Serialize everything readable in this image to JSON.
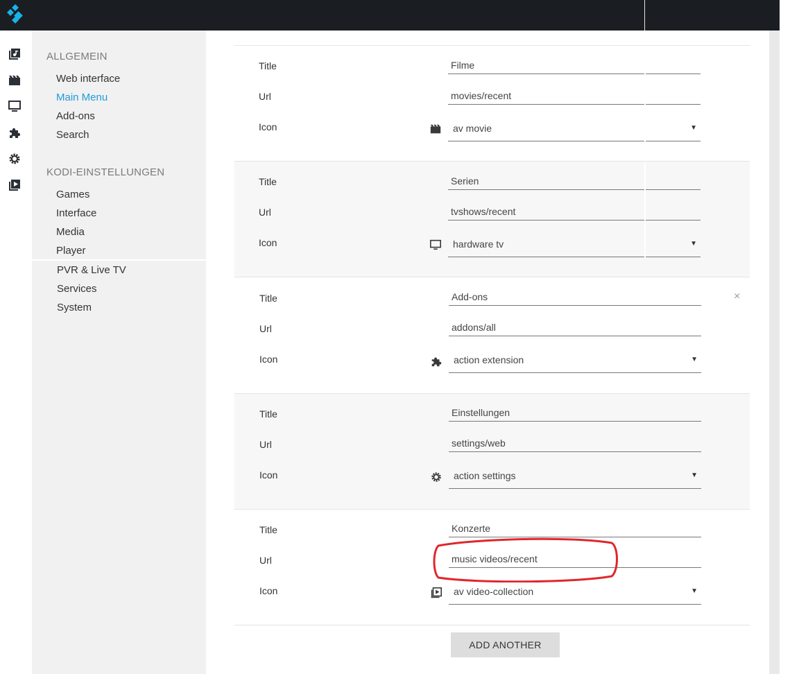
{
  "sidebar": {
    "sections": [
      {
        "heading": "ALLGEMEIN",
        "items": [
          {
            "label": "Web interface"
          },
          {
            "label": "Main Menu"
          },
          {
            "label": "Add-ons"
          },
          {
            "label": "Search"
          }
        ]
      },
      {
        "heading": "KODI-EINSTELLUNGEN",
        "items": [
          {
            "label": "Games"
          },
          {
            "label": "Interface"
          },
          {
            "label": "Media"
          },
          {
            "label": "Player"
          },
          {
            "label": "PVR & Live TV"
          },
          {
            "label": "Services"
          },
          {
            "label": "System"
          }
        ]
      }
    ]
  },
  "rail": {
    "icons": [
      "music-library-icon",
      "movies-icon",
      "tv-icon",
      "addons-icon",
      "settings-icon",
      "video-collection-icon"
    ]
  },
  "form": {
    "labels": {
      "title": "Title",
      "url": "Url",
      "icon": "Icon"
    },
    "items": [
      {
        "title": "Filme",
        "url": "movies/recent",
        "icon_value": "av movie",
        "icon_name": "movie-icon"
      },
      {
        "title": "Serien",
        "url": "tvshows/recent",
        "icon_value": "hardware tv",
        "icon_name": "tv-icon"
      },
      {
        "title": "Add-ons",
        "url": "addons/all",
        "icon_value": "action extension",
        "icon_name": "extension-icon"
      },
      {
        "title": "Einstellungen",
        "url": "settings/web",
        "icon_value": "action settings",
        "icon_name": "settings-icon"
      },
      {
        "title": "Konzerte",
        "url": "music videos/recent",
        "icon_value": "av video-collection",
        "icon_name": "video-collection-icon"
      }
    ],
    "remove_glyph": "×",
    "caret": "▼",
    "add_label": "ADD ANOTHER"
  },
  "colors": {
    "topbar": "#1a1d22",
    "accent": "#1f9bd7",
    "highlight": "#e0262c",
    "sidebar": "#f1f1f1"
  }
}
